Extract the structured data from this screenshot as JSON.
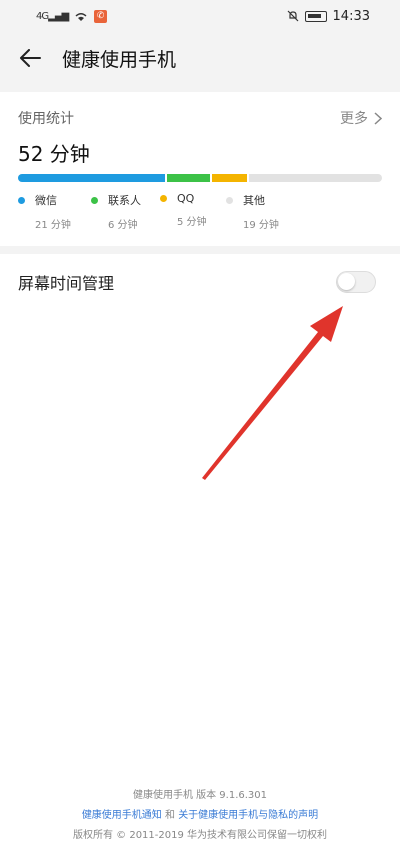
{
  "status_bar": {
    "signal": "4G",
    "time": "14:33"
  },
  "header": {
    "title": "健康使用手机"
  },
  "usage": {
    "label": "使用统计",
    "more_label": "更多",
    "total": "52 分钟",
    "apps": [
      {
        "name": "微信",
        "minutes_label": "21 分钟",
        "minutes": 21,
        "color": "#1e9be0"
      },
      {
        "name": "联系人",
        "minutes_label": "6 分钟",
        "minutes": 6,
        "color": "#3cc247"
      },
      {
        "name": "QQ",
        "minutes_label": "5 分钟",
        "minutes": 5,
        "color": "#f4b400"
      },
      {
        "name": "其他",
        "minutes_label": "19 分钟",
        "minutes": 19,
        "color": "#e2e2e2"
      }
    ]
  },
  "screen_time": {
    "label": "屏幕时间管理",
    "enabled": false
  },
  "footer": {
    "version_line": "健康使用手机 版本 9.1.6.301",
    "link_notice": "健康使用手机通知",
    "and": "和",
    "link_privacy": "关于健康使用手机与隐私的声明",
    "copyright": "版权所有 © 2011-2019 华为技术有限公司保留一切权利"
  },
  "colors": {
    "annotation_arrow": "#e0342c",
    "link": "#3a7bd5"
  }
}
